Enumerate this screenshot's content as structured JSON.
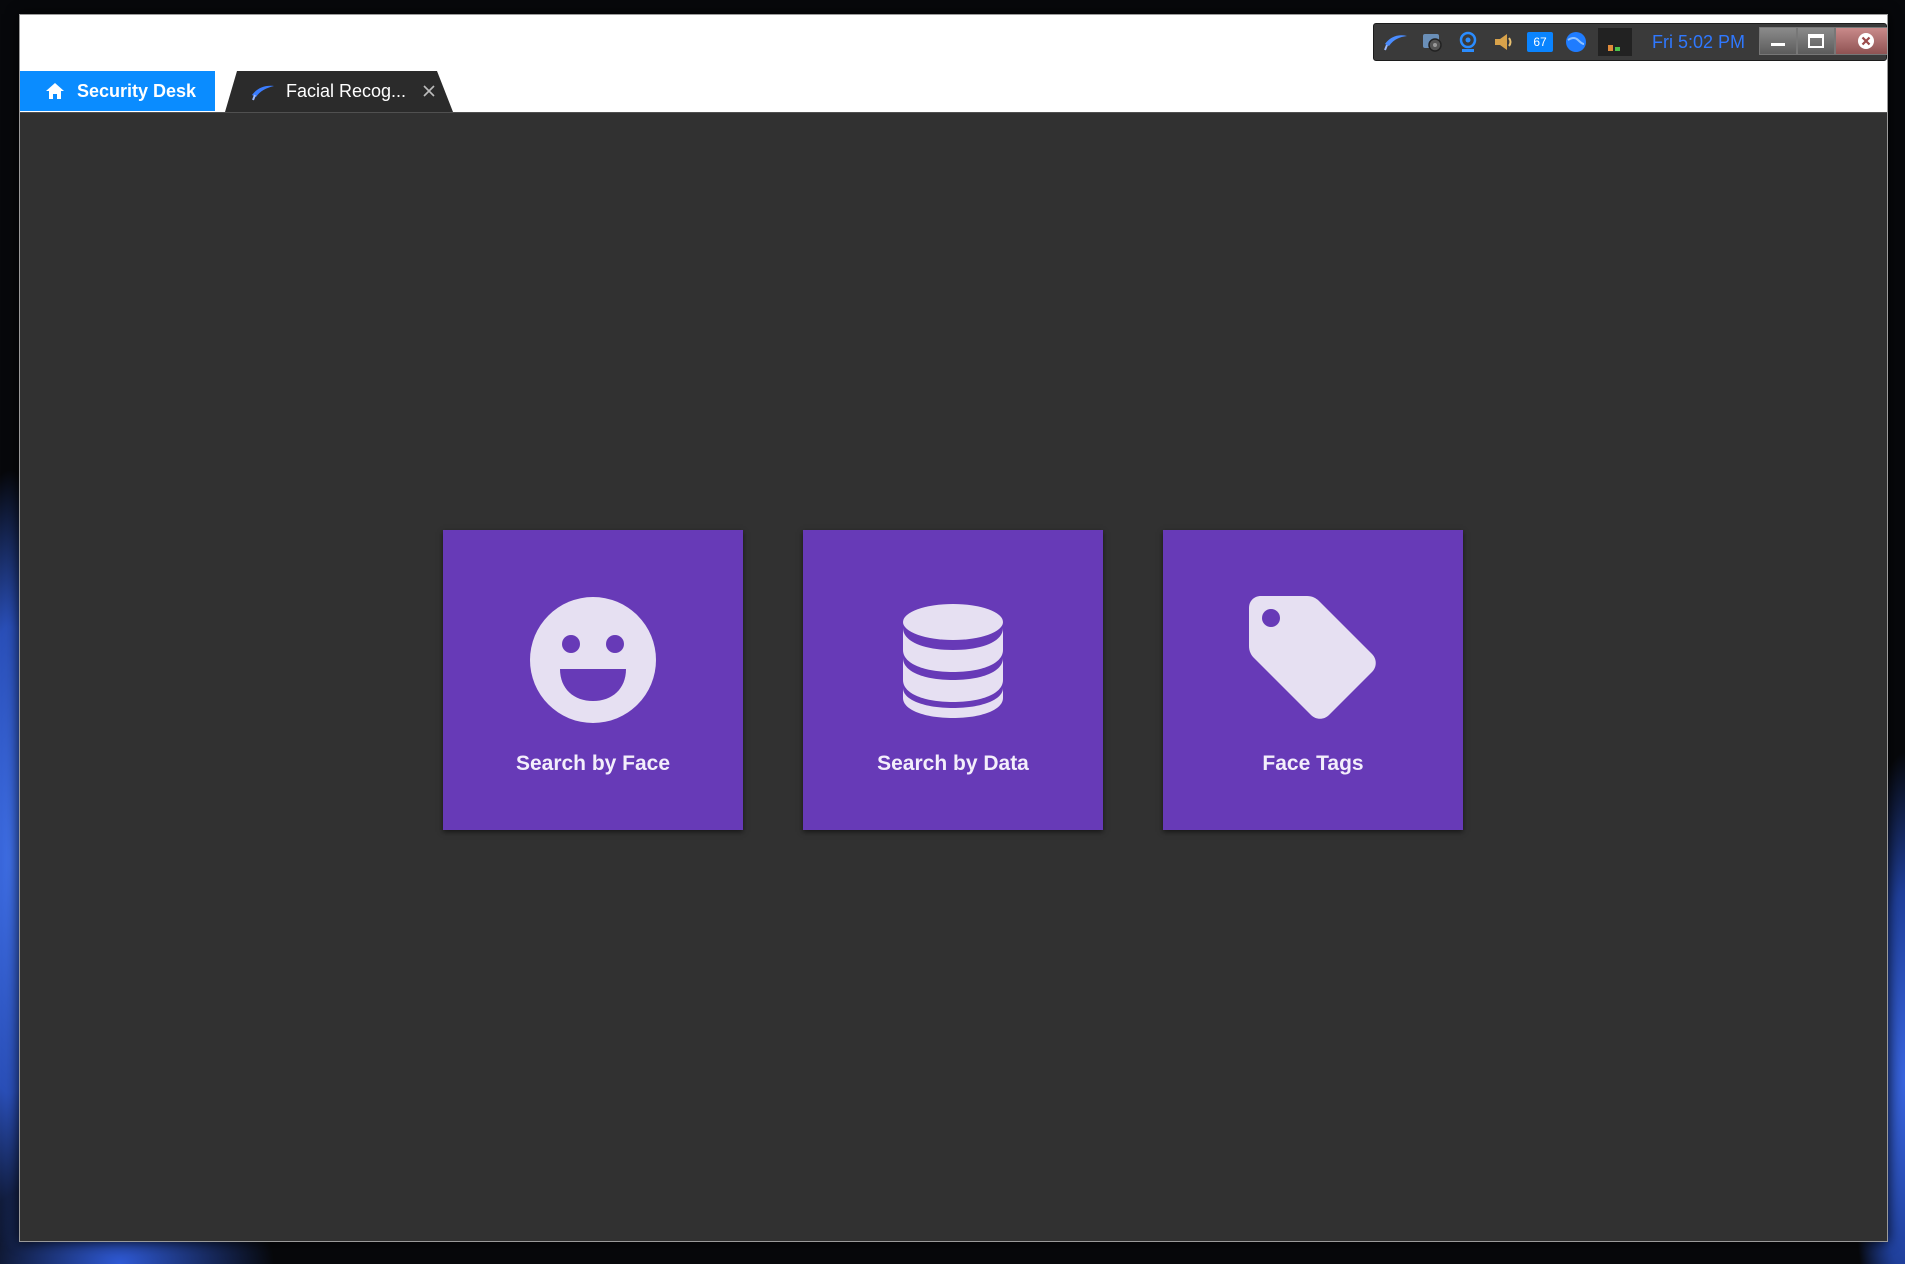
{
  "tray": {
    "icons": [
      "app-logo-icon",
      "monitor-icon",
      "camera-icon",
      "speaker-icon",
      "notification-count",
      "globe-icon",
      "network-icon"
    ],
    "notification_count": "67",
    "clock": "Fri 5:02 PM",
    "buttons": [
      "minimize",
      "maximize",
      "close"
    ]
  },
  "tabs": {
    "home_label": "Security Desk",
    "active_tab_label": "Facial Recog..."
  },
  "tiles": [
    {
      "label": "Search by Face",
      "icon": "smiley-face-icon"
    },
    {
      "label": "Search by Data",
      "icon": "database-icon"
    },
    {
      "label": "Face Tags",
      "icon": "tag-icon"
    }
  ],
  "colors": {
    "accent_blue": "#0a8cff",
    "tile_purple": "#673ab7",
    "content_bg": "#313131",
    "icon_fill": "#e6e0f2",
    "clock_blue": "#2f78ff"
  }
}
